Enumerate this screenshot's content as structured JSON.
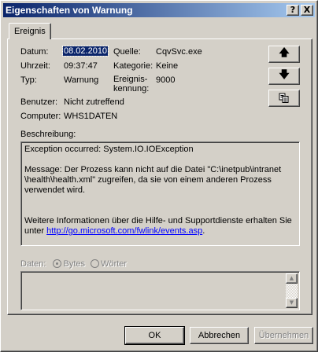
{
  "window": {
    "title": "Eigenschaften von Warnung",
    "help_button": "?",
    "close_button": "X"
  },
  "tab": {
    "label": "Ereignis"
  },
  "fields": {
    "datum_label": "Datum:",
    "datum_value": "08.02.2010",
    "uhrzeit_label": "Uhrzeit:",
    "uhrzeit_value": "09:37:47",
    "typ_label": "Typ:",
    "typ_value": "Warnung",
    "benutzer_label": "Benutzer:",
    "benutzer_value": "Nicht zutreffend",
    "computer_label": "Computer:",
    "computer_value": "WHS1DATEN",
    "quelle_label": "Quelle:",
    "quelle_value": "CqvSvc.exe",
    "kategorie_label": "Kategorie:",
    "kategorie_value": "Keine",
    "ereignis_label_line1": "Ereignis-",
    "ereignis_label_line2": "kennung:",
    "ereignis_value": "9000"
  },
  "nav_buttons": {
    "up_icon": "up-arrow-icon",
    "down_icon": "down-arrow-icon",
    "copy_icon": "copy-icon"
  },
  "description": {
    "label": "Beschreibung:",
    "line1": "Exception occurred:  System.IO.IOException",
    "line2": "Message:  Der Prozess kann nicht auf die Datei \"C:\\inetpub\\intranet \\health\\health.xml\" zugreifen, da sie von einem anderen Prozess verwendet wird.",
    "line3_prefix": "Weitere Informationen über die Hilfe- und Supportdienste erhalten Sie unter ",
    "link": "http://go.microsoft.com/fwlink/events.asp",
    "line3_suffix": "."
  },
  "data": {
    "label": "Daten:",
    "option_bytes": "Bytes",
    "option_words": "Wörter",
    "selected": "Bytes"
  },
  "footer": {
    "ok": "OK",
    "cancel": "Abbrechen",
    "apply": "Übernehmen"
  },
  "colors": {
    "title_start": "#0a246a",
    "title_end": "#a6caf0",
    "face": "#d4d0c8",
    "link": "#0000ff"
  }
}
